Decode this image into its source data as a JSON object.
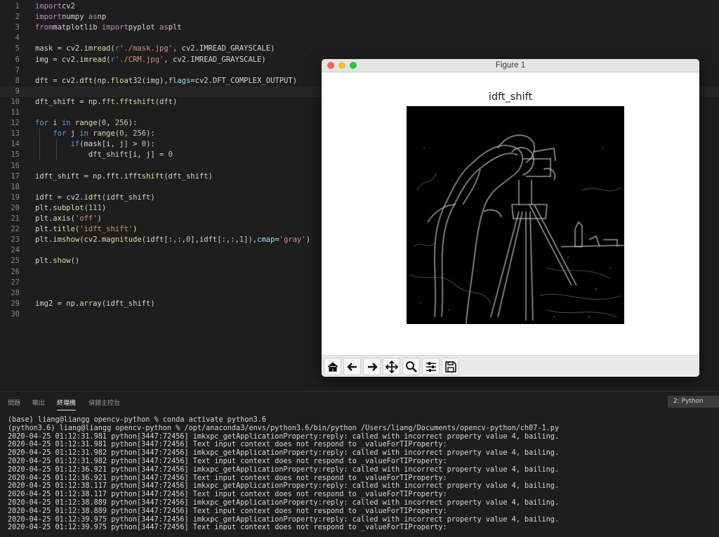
{
  "editor": {
    "line_numbers": [
      "1",
      "2",
      "3",
      "4",
      "5",
      "6",
      "7",
      "8",
      "9",
      "10",
      "11",
      "12",
      "13",
      "14",
      "15",
      "16",
      "17",
      "18",
      "19",
      "20",
      "21",
      "22",
      "23",
      "24",
      "25",
      "26",
      "27",
      "28",
      "29",
      "30"
    ],
    "lines": [
      [
        [
          "k-import",
          "import"
        ],
        [
          "",
          "cv2"
        ]
      ],
      [
        [
          "k-import",
          "import"
        ],
        [
          "",
          "numpy "
        ],
        [
          "k-import",
          "as"
        ],
        [
          "",
          "np"
        ]
      ],
      [
        [
          "k-import",
          "from"
        ],
        [
          "",
          "matplotlib "
        ],
        [
          "k-import",
          "import"
        ],
        [
          "",
          "pyplot "
        ],
        [
          "k-import",
          "as"
        ],
        [
          "",
          "plt"
        ]
      ],
      [],
      [
        [
          "",
          "mask = cv2."
        ],
        [
          "k-fn",
          "imread"
        ],
        [
          "",
          "("
        ],
        [
          "k-kw",
          "r"
        ],
        [
          "k-str",
          "'./mask.jpg'"
        ],
        [
          "",
          ", cv2.IMREAD_GRAYSCALE)"
        ]
      ],
      [
        [
          "",
          "img = cv2."
        ],
        [
          "k-fn",
          "imread"
        ],
        [
          "",
          "("
        ],
        [
          "k-kw",
          "r"
        ],
        [
          "k-str",
          "'./CRM.jpg'"
        ],
        [
          "",
          ", cv2.IMREAD_GRAYSCALE)"
        ]
      ],
      [],
      [
        [
          "",
          "dft = cv2."
        ],
        [
          "k-fn",
          "dft"
        ],
        [
          "",
          "(np."
        ],
        [
          "k-fn",
          "float32"
        ],
        [
          "",
          "(img),"
        ],
        [
          "k-param",
          "flags"
        ],
        [
          "",
          "=cv2.DFT_COMPLEX_OUTPUT)"
        ]
      ],
      [],
      [
        [
          "",
          "dft_shift = np.fft."
        ],
        [
          "k-fn",
          "fftshift"
        ],
        [
          "",
          "(dft)"
        ]
      ],
      [],
      [
        [
          "k-kw",
          "for"
        ],
        [
          "",
          " i "
        ],
        [
          "k-kw",
          "in"
        ],
        [
          "",
          ""
        ],
        [
          "k-fn",
          " range"
        ],
        [
          "",
          "("
        ],
        [
          "k-num",
          "0"
        ],
        [
          "",
          ", "
        ],
        [
          "k-num",
          "256"
        ],
        [
          "",
          "):"
        ]
      ],
      [
        [
          "",
          "    "
        ],
        [
          "k-kw",
          "for"
        ],
        [
          "",
          " j "
        ],
        [
          "k-kw",
          "in"
        ],
        [
          "k-fn",
          " range"
        ],
        [
          "",
          "("
        ],
        [
          "k-num",
          "0"
        ],
        [
          "",
          ", "
        ],
        [
          "k-num",
          "256"
        ],
        [
          "",
          "):"
        ]
      ],
      [
        [
          "",
          "        "
        ],
        [
          "k-kw",
          "if"
        ],
        [
          "",
          "(mask[i, j] > "
        ],
        [
          "k-num",
          "0"
        ],
        [
          "",
          "):"
        ]
      ],
      [
        [
          "",
          "            dft_shift[i, j] = "
        ],
        [
          "k-num",
          "0"
        ]
      ],
      [],
      [
        [
          "",
          "idft_shift = np.fft."
        ],
        [
          "k-fn",
          "ifftshift"
        ],
        [
          "",
          "(dft_shift)"
        ]
      ],
      [],
      [
        [
          "",
          "idft = cv2."
        ],
        [
          "k-fn",
          "idft"
        ],
        [
          "",
          "(idft_shift)"
        ]
      ],
      [
        [
          "",
          "plt."
        ],
        [
          "k-fn",
          "subplot"
        ],
        [
          "",
          "("
        ],
        [
          "k-num",
          "111"
        ],
        [
          "",
          ")"
        ]
      ],
      [
        [
          "",
          "plt."
        ],
        [
          "k-fn",
          "axis"
        ],
        [
          "",
          "("
        ],
        [
          "k-str",
          "'off'"
        ],
        [
          "",
          ")"
        ]
      ],
      [
        [
          "",
          "plt."
        ],
        [
          "k-fn",
          "title"
        ],
        [
          "",
          "("
        ],
        [
          "k-str",
          "'idft_shift'"
        ],
        [
          "",
          ")"
        ]
      ],
      [
        [
          "",
          "plt."
        ],
        [
          "k-fn",
          "imshow"
        ],
        [
          "",
          "(cv2."
        ],
        [
          "k-fn",
          "magnitude"
        ],
        [
          "",
          "(idft[:,:,"
        ],
        [
          "k-num",
          "0"
        ],
        [
          "",
          "],idft[:,:,"
        ],
        [
          "k-num",
          "1"
        ],
        [
          "",
          "]),"
        ],
        [
          "k-param",
          "cmap"
        ],
        [
          "",
          "="
        ],
        [
          "k-str",
          "'gray'"
        ],
        [
          "",
          ")"
        ]
      ],
      [],
      [
        [
          "",
          "plt."
        ],
        [
          "k-fn",
          "show"
        ],
        [
          "",
          "()"
        ]
      ],
      [],
      [],
      [],
      [
        [
          "",
          "img2 = np."
        ],
        [
          "k-fn",
          "array"
        ],
        [
          "",
          "(idft_shift)"
        ]
      ],
      []
    ]
  },
  "figure": {
    "window_title": "Figure 1",
    "plot_title": "idft_shift",
    "toolbar": [
      "home-icon",
      "back-arrow-icon",
      "forward-arrow-icon",
      "pan-icon",
      "zoom-icon",
      "configure-subplots-icon",
      "save-icon"
    ],
    "traffic_lights": {
      "close": "#fe5f57",
      "minimize": "#febc2e",
      "zoom": "#28c840"
    }
  },
  "panel": {
    "tabs": [
      "問題",
      "輸出",
      "終端機",
      "偵錯主控台"
    ],
    "active_tab": "終端機",
    "terminal_select": "2: Python"
  },
  "terminal": {
    "lines": [
      "(base) liang@liangg opencv-python % conda activate python3.6",
      "(python3.6) liang@liangg opencv-python % /opt/anaconda3/envs/python3.6/bin/python /Users/liang/Documents/opencv-python/ch07-1.py",
      "2020-04-25 01:12:31.981 python[3447:72456] imkxpc_getApplicationProperty:reply: called with incorrect property value 4, bailing.",
      "2020-04-25 01:12:31.981 python[3447:72456] Text input context does not respond to _valueForTIProperty:",
      "2020-04-25 01:12:31.982 python[3447:72456] imkxpc_getApplicationProperty:reply: called with incorrect property value 4, bailing.",
      "2020-04-25 01:12:31.982 python[3447:72456] Text input context does not respond to _valueForTIProperty:",
      "2020-04-25 01:12:36.921 python[3447:72456] imkxpc_getApplicationProperty:reply: called with incorrect property value 4, bailing.",
      "2020-04-25 01:12:36.921 python[3447:72456] Text input context does not respond to _valueForTIProperty:",
      "2020-04-25 01:12:38.117 python[3447:72456] imkxpc_getApplicationProperty:reply: called with incorrect property value 4, bailing.",
      "2020-04-25 01:12:38.117 python[3447:72456] Text input context does not respond to _valueForTIProperty:",
      "2020-04-25 01:12:38.889 python[3447:72456] imkxpc_getApplicationProperty:reply: called with incorrect property value 4, bailing.",
      "2020-04-25 01:12:38.889 python[3447:72456] Text input context does not respond to _valueForTIProperty:",
      "2020-04-25 01:12:39.975 python[3447:72456] imkxpc_getApplicationProperty:reply: called with incorrect property value 4, bailing.",
      "2020-04-25 01:12:39.975 python[3447:72456] Text input context does not respond to _valueForTIProperty:"
    ]
  }
}
